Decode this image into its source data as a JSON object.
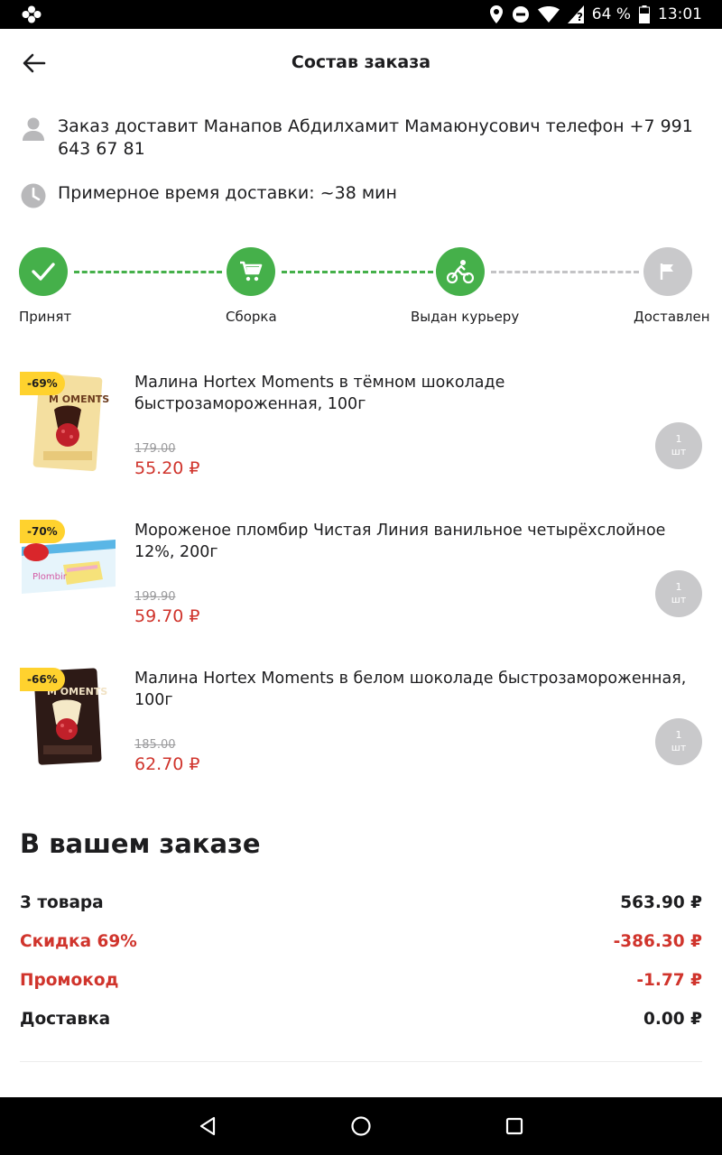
{
  "status_bar": {
    "battery_percent": "64 %",
    "time": "13:01"
  },
  "header": {
    "title": "Состав заказа"
  },
  "courier": {
    "text": "Заказ доставит Манапов Абдилхамит Мамаюнусович  телефон +7 991 643 67 81"
  },
  "delivery": {
    "text": "Примерное время доставки: ~38 мин"
  },
  "steps": [
    {
      "label": "Принят",
      "state": "done",
      "icon": "check-icon"
    },
    {
      "label": "Сборка",
      "state": "done",
      "icon": "cart-icon"
    },
    {
      "label": "Выдан курьеру",
      "state": "done",
      "icon": "courier-bike-icon"
    },
    {
      "label": "Доставлен",
      "state": "pending",
      "icon": "flag-icon"
    }
  ],
  "products": [
    {
      "name": "Малина Hortex Moments в тёмном шоколаде быстрозамороженная, 100г",
      "discount": "-69%",
      "old_price": "179.00",
      "price": "55.20 ₽",
      "qty": "1",
      "unit": "шт"
    },
    {
      "name": "Мороженое пломбир Чистая Линия ванильное четырёхслойное 12%, 200г",
      "discount": "-70%",
      "old_price": "199.90",
      "price": "59.70 ₽",
      "qty": "1",
      "unit": "шт"
    },
    {
      "name": "Малина Hortex Moments в белом шоколаде быстрозамороженная, 100г",
      "discount": "-66%",
      "old_price": "185.00",
      "price": "62.70 ₽",
      "qty": "1",
      "unit": "шт"
    }
  ],
  "summary": {
    "title": "В вашем заказе",
    "rows": [
      {
        "label": "3 товара",
        "value": "563.90 ₽",
        "highlight": false
      },
      {
        "label": "Скидка 69%",
        "value": "-386.30 ₽",
        "highlight": true
      },
      {
        "label": "Промокод",
        "value": "-1.77 ₽",
        "highlight": true
      },
      {
        "label": "Доставка",
        "value": "0.00 ₽",
        "highlight": false
      }
    ]
  },
  "colors": {
    "accent_green": "#45b04a",
    "price_red": "#d0342c",
    "badge_yellow": "#ffd22e",
    "pending_grey": "#c9c9cb"
  }
}
